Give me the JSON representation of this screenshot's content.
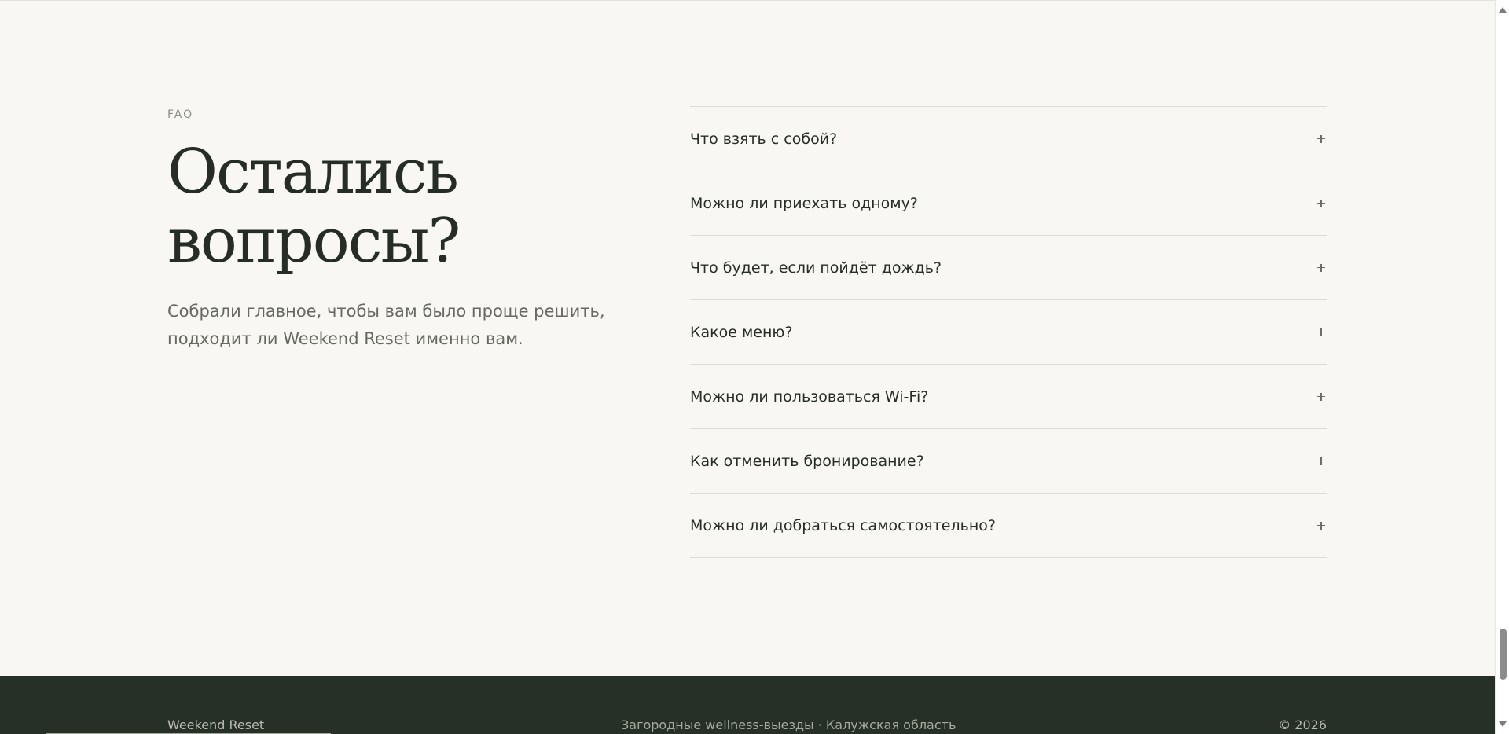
{
  "faq": {
    "eyebrow": "FAQ",
    "title_line1": "Остались",
    "title_line2": "вопросы?",
    "lead": "Собрали главное, чтобы вам было проще решить, подходит ли Weekend Reset именно вам.",
    "items": [
      {
        "question": "Что взять с собой?",
        "icon": "plus-icon"
      },
      {
        "question": "Можно ли приехать одному?",
        "icon": "plus-icon"
      },
      {
        "question": "Что будет, если пойдёт дождь?",
        "icon": "plus-icon"
      },
      {
        "question": "Какое меню?",
        "icon": "plus-icon"
      },
      {
        "question": "Можно ли пользоваться Wi-Fi?",
        "icon": "plus-icon"
      },
      {
        "question": "Как отменить бронирование?",
        "icon": "plus-icon"
      },
      {
        "question": "Можно ли добраться самостоятельно?",
        "icon": "plus-icon"
      }
    ]
  },
  "footer": {
    "brand": "Weekend Reset",
    "tagline": "Загородные wellness-выезды · Калужская область",
    "copyright": "© 2026"
  },
  "colors": {
    "page_background": "#f8f7f3",
    "text_dark": "#262d27",
    "footer_background": "#263027",
    "divider": "#dcdbd5"
  },
  "scrollbar": {
    "up_icon": "chevron-up-icon",
    "down_icon": "chevron-down-icon"
  }
}
